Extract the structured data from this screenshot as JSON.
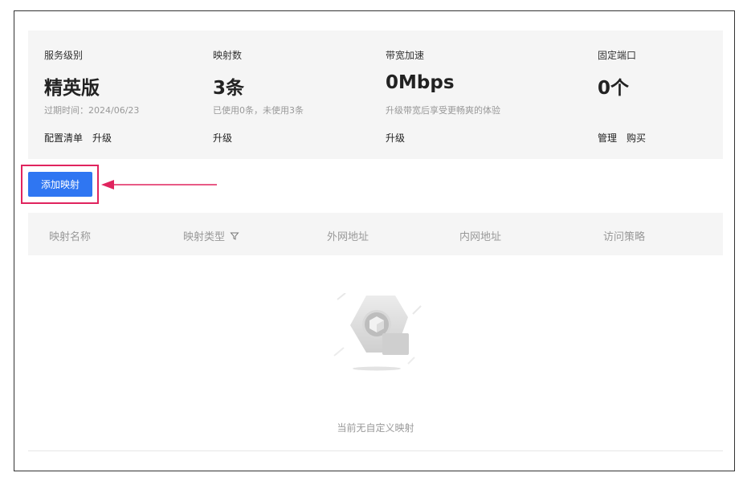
{
  "stats": [
    {
      "label": "服务级别",
      "value": "精英版",
      "sub": "过期时间：2024/06/23",
      "actions": [
        "配置清单",
        "升级"
      ]
    },
    {
      "label": "映射数",
      "value": "3条",
      "sub": "已使用0条，未使用3条",
      "actions": [
        "升级"
      ]
    },
    {
      "label": "带宽加速",
      "value": "0Mbps",
      "sub": "升级带宽后享受更畅爽的体验",
      "actions": [
        "升级"
      ]
    },
    {
      "label": "固定端口",
      "value": "0个",
      "sub": "",
      "actions": [
        "管理",
        "购买"
      ]
    }
  ],
  "toolbar": {
    "add_label": "添加映射"
  },
  "table": {
    "columns": [
      "映射名称",
      "映射类型",
      "外网地址",
      "内网地址",
      "访问策略"
    ],
    "rows": []
  },
  "empty": {
    "text": "当前无自定义映射"
  },
  "colors": {
    "primary": "#2f76f2",
    "highlight": "#e0245e",
    "panel_bg": "#f5f5f5"
  }
}
